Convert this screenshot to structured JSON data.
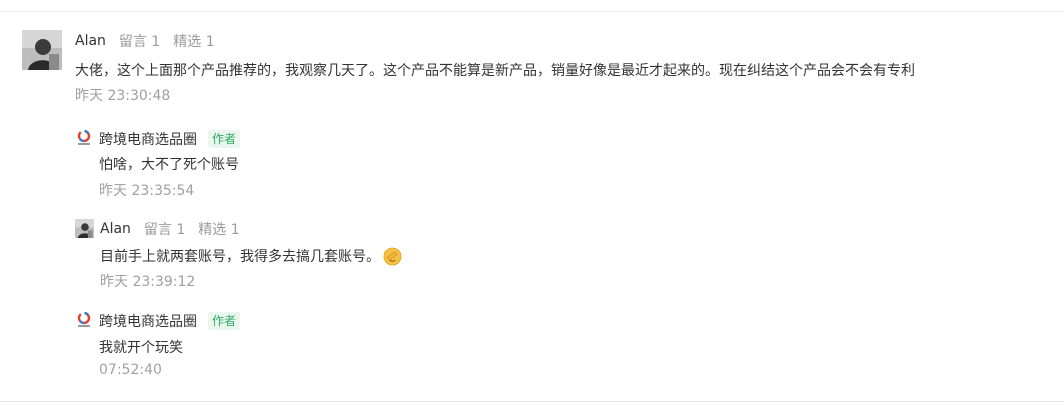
{
  "comments": [
    {
      "author": "Alan",
      "replies_label": "留言 1",
      "featured_label": "精选 1",
      "text": "大佬，这个上面那个产品推荐的，我观察几天了。这个产品不能算是新产品，销量好像是最近才起来的。现在纠结这个产品会不会有专利",
      "time": "昨天 23:30:48"
    },
    {
      "author": "跨境电商选品圈",
      "author_tag": "作者",
      "text": "怕啥，大不了死个账号",
      "time": "昨天 23:35:54"
    },
    {
      "author": "Alan",
      "replies_label": "留言 1",
      "featured_label": "精选 1",
      "text": "目前手上就两套账号，我得多去搞几套账号。",
      "time": "昨天 23:39:12"
    },
    {
      "author": "跨境电商选品圈",
      "author_tag": "作者",
      "text": "我就开个玩笑",
      "time": "07:52:40"
    }
  ],
  "icons": {
    "avatar": "user-avatar-photo",
    "author_logo": "brand-logo-icon",
    "emoji": "facepalm-emoji-icon"
  },
  "colors": {
    "author_tag_text": "#2ea862",
    "author_tag_bg": "#eaf7ef",
    "meta_gray": "#9a9a9a",
    "text": "#333333"
  }
}
